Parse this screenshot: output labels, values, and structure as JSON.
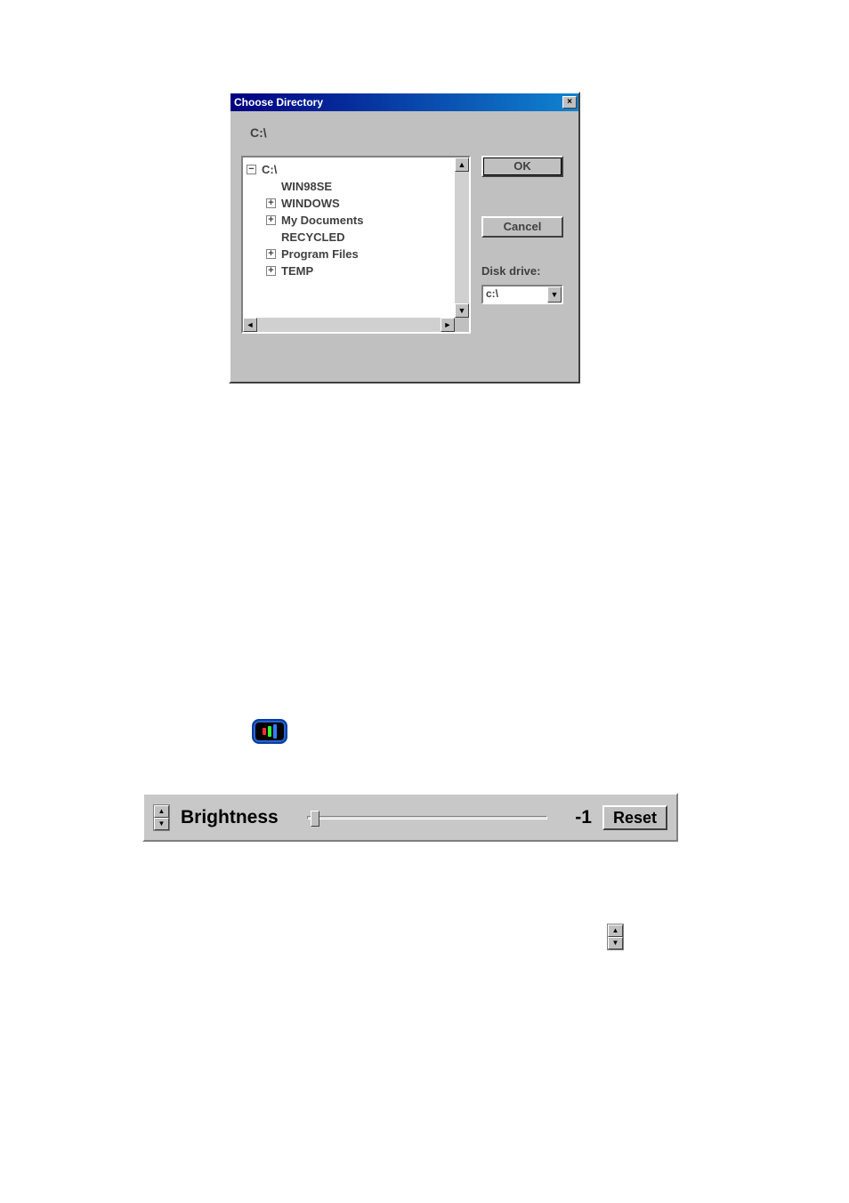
{
  "dialog": {
    "title": "Choose Directory",
    "close_glyph": "×",
    "current_path": "C:\\",
    "tree": {
      "root": {
        "label": "C:\\",
        "expander": "−"
      },
      "children": [
        {
          "label": "WIN98SE",
          "expander": ""
        },
        {
          "label": "WINDOWS",
          "expander": "+"
        },
        {
          "label": "My Documents",
          "expander": "+"
        },
        {
          "label": "RECYCLED",
          "expander": ""
        },
        {
          "label": "Program Files",
          "expander": "+"
        },
        {
          "label": "TEMP",
          "expander": "+"
        }
      ]
    },
    "scroll": {
      "up": "▲",
      "down": "▼",
      "left": "◄",
      "right": "►"
    },
    "buttons": {
      "ok": "OK",
      "cancel": "Cancel"
    },
    "disk_drive_label": "Disk drive:",
    "disk_drive_value": "c:\\",
    "combo_arrow": "▼"
  },
  "brightness": {
    "spinner_up": "▲",
    "spinner_down": "▼",
    "label": "Brightness",
    "value": "-1",
    "reset": "Reset"
  },
  "standalone_spinner": {
    "up": "▲",
    "down": "▼"
  }
}
